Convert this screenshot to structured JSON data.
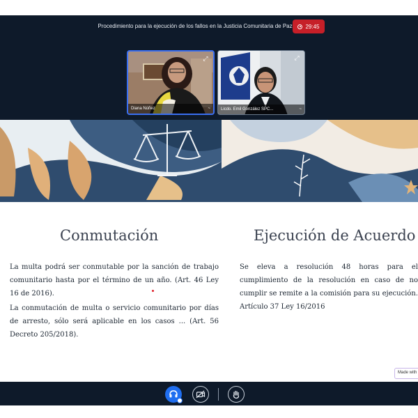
{
  "meeting": {
    "title": "Procedimiento para la ejecución de los fallos en la Justicia Comunitaria de Paz",
    "timer": "29:45",
    "participants": [
      {
        "name": "Diana Núñez",
        "suffix": "~"
      },
      {
        "name": "Licdo. Emil González SPC...",
        "suffix": "~"
      }
    ]
  },
  "slide": {
    "left": {
      "heading": "Conmutación",
      "paragraphs": [
        "La multa podrá ser conmutable por la sanción de trabajo comunitario hasta por el término de un año. (Art. 46 Ley 16 de 2016).",
        "La conmutación de multa o servicio comunitario por días de arresto, sólo será aplicable en los casos ... (Art. 56 Decreto 205/2018)."
      ]
    },
    "right": {
      "heading": "Ejecución de Acuerdo",
      "paragraph": "Se eleva a resolución 48 horas para el cumplimiento de la resolución en caso de no cumplir se remite a la comisión para su ejecución. Artículo 37 Ley 16/2016"
    },
    "badge": "Made with"
  },
  "colors": {
    "meeting_bg": "#0e1a2a",
    "record": "#c61f28",
    "active_button": "#1f6ef0"
  },
  "icons": {
    "headset": "headset-icon",
    "camera_off": "camera-off-icon",
    "raise_hand": "raise-hand-icon",
    "expand": "expand-icon"
  }
}
